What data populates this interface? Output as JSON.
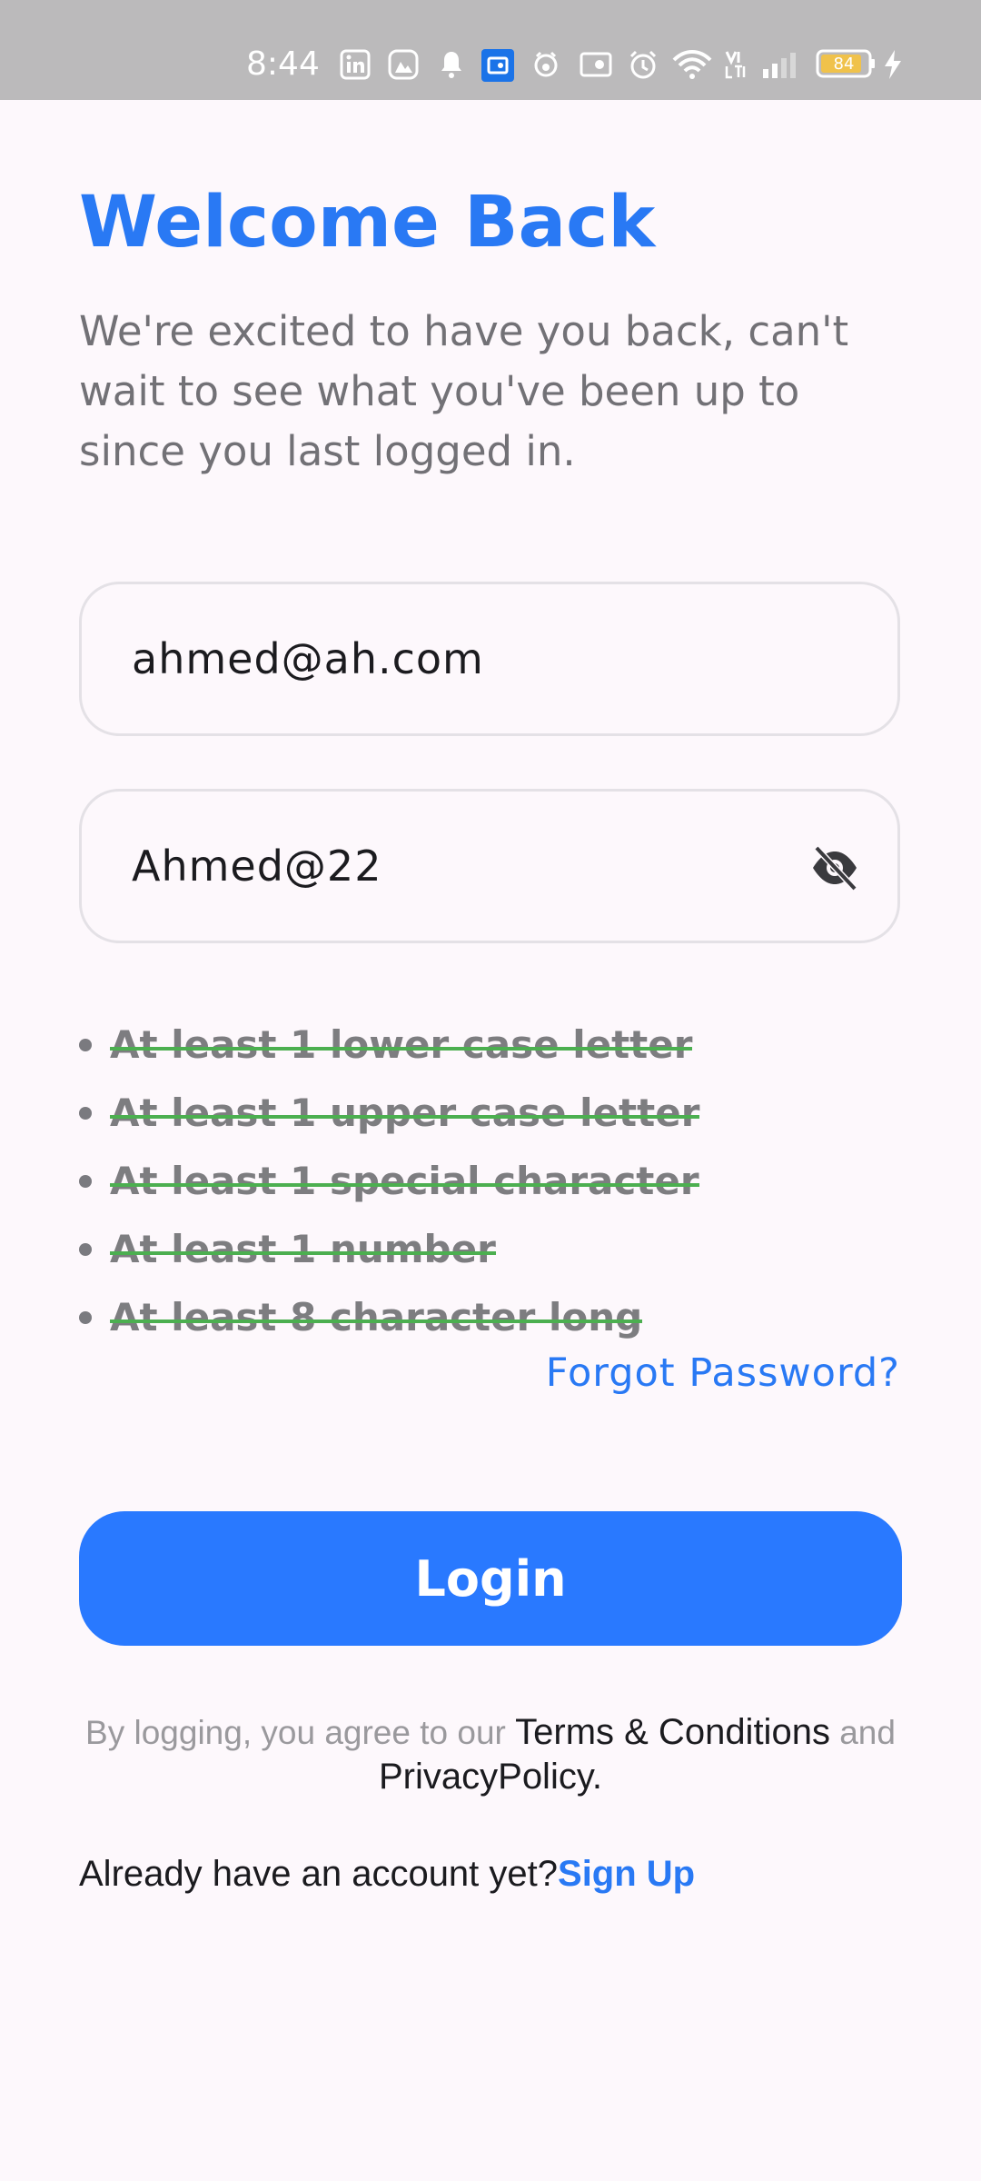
{
  "status_bar": {
    "time": "8:44",
    "battery_level": "84",
    "icons": [
      "linkedin-icon",
      "gallery-app-icon",
      "notification-bell-icon",
      "app-notification-icon",
      "pet-app-icon",
      "cast-icon",
      "alarm-icon",
      "wifi-icon",
      "volte-icon",
      "signal-icon",
      "battery-icon",
      "charging-icon"
    ]
  },
  "header": {
    "title": "Welcome Back",
    "subtitle": "We're excited to have you back, can't wait to see what you've been up to since you last logged in."
  },
  "form": {
    "email_value": "ahmed@ah.com",
    "password_value": "Ahmed@22",
    "password_toggle_icon": "eye-off-icon"
  },
  "password_rules": [
    {
      "label": "At least 1 lower case letter",
      "satisfied": true
    },
    {
      "label": "At least 1 upper case letter",
      "satisfied": true
    },
    {
      "label": "At least 1 special character",
      "satisfied": true
    },
    {
      "label": "At least 1 number",
      "satisfied": true
    },
    {
      "label": "At least 8 character long",
      "satisfied": true
    }
  ],
  "links": {
    "forgot_password": "Forgot Password?"
  },
  "login_button": {
    "label": "Login"
  },
  "terms": {
    "prefix": "By logging, you agree to our ",
    "terms_label": "Terms & Conditions",
    "conjunction": " and",
    "privacy_label": "PrivacyPolicy."
  },
  "signup": {
    "prompt": "Already have an account yet?",
    "link": "Sign Up"
  },
  "colors": {
    "accent": "#2979f4",
    "rule_strike": "#4caf50",
    "background": "#fdf8fc",
    "status_bar": "#bbbabb"
  }
}
